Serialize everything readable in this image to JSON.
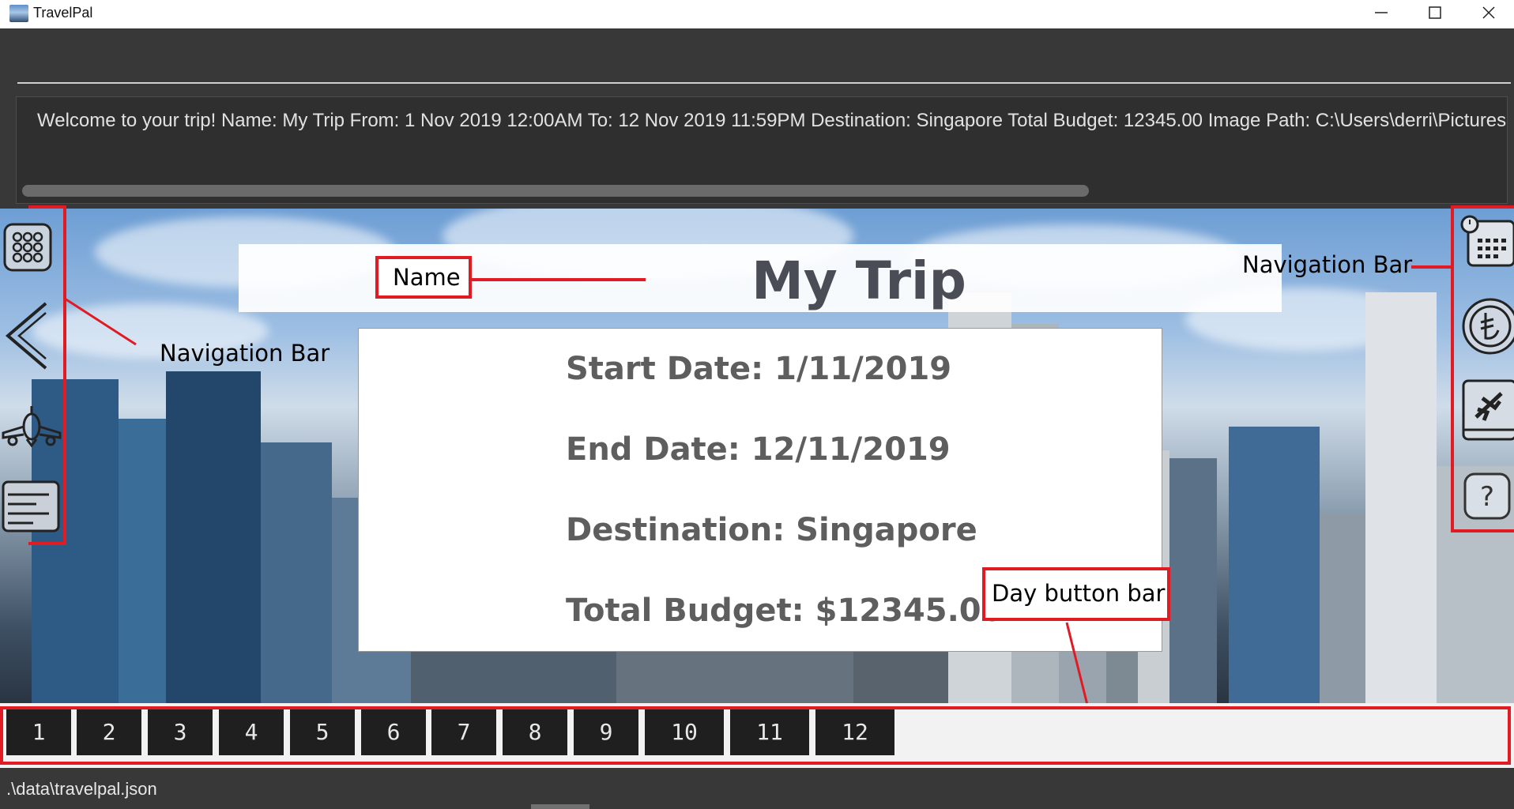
{
  "window": {
    "title": "TravelPal",
    "icons": [
      "app-icon",
      "minimize-icon",
      "maximize-icon",
      "close-icon"
    ]
  },
  "result": {
    "text": "Welcome to your trip! Name: My Trip From: 1 Nov 2019 12:00AM To: 12 Nov 2019 11:59PM Destination: Singapore Total Budget: 12345.00 Image Path: C:\\Users\\derri\\Pictures"
  },
  "trip": {
    "name": "My Trip",
    "start_date": "Start Date: 1/11/2019",
    "end_date": "End Date: 12/11/2019",
    "destination": "Destination: Singapore",
    "total_budget": "Total Budget: $12345.00"
  },
  "nav_left": {
    "icons": [
      "grid-icon",
      "back-chevron-icon",
      "airplane-icon",
      "list-icon"
    ]
  },
  "nav_right": {
    "icons": [
      "calendar-clock-icon",
      "currency-coin-icon",
      "travel-book-icon",
      "help-icon"
    ]
  },
  "annotations": {
    "name": "Name",
    "nav_left": "Navigation Bar",
    "nav_right": "Navigation Bar",
    "day_bar": "Day button bar",
    "color": "#e01b24"
  },
  "days": [
    "1",
    "2",
    "3",
    "4",
    "5",
    "6",
    "7",
    "8",
    "9",
    "10",
    "11",
    "12"
  ],
  "status": {
    "path": ".\\data\\travelpal.json"
  }
}
